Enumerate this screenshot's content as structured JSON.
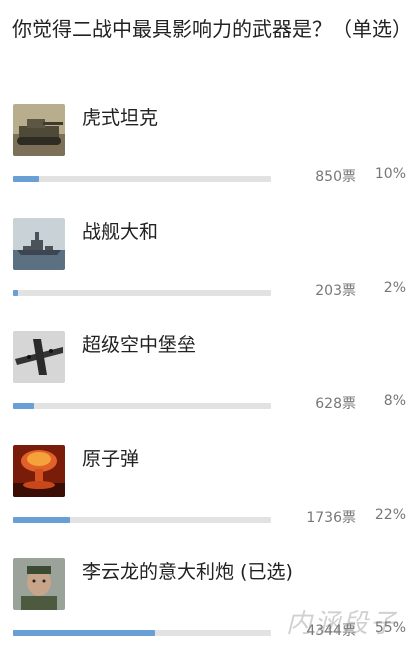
{
  "question": "你觉得二战中最具影响力的武器是？（单选）",
  "options": [
    {
      "label": "虎式坦克",
      "votes": "850票",
      "percent": "10%",
      "share": 0.1,
      "image": "tiger-tank-thumbnail"
    },
    {
      "label": "战舰大和",
      "votes": "203票",
      "percent": "2%",
      "share": 0.02,
      "image": "battleship-yamato-thumbnail"
    },
    {
      "label": "超级空中堡垒",
      "votes": "628票",
      "percent": "8%",
      "share": 0.08,
      "image": "b29-bomber-thumbnail"
    },
    {
      "label": "原子弹",
      "votes": "1736票",
      "percent": "22%",
      "share": 0.22,
      "image": "atomic-bomb-thumbnail"
    },
    {
      "label": "李云龙的意大利炮 (已选)",
      "votes": "4344票",
      "percent": "55%",
      "share": 0.55,
      "image": "li-yunlong-thumbnail"
    }
  ],
  "watermark": "内涵段子",
  "colors": {
    "bar_fill": "#6a9fd6",
    "bar_track": "#e2e2e2",
    "text": "#222222",
    "meta_text": "#777777"
  }
}
